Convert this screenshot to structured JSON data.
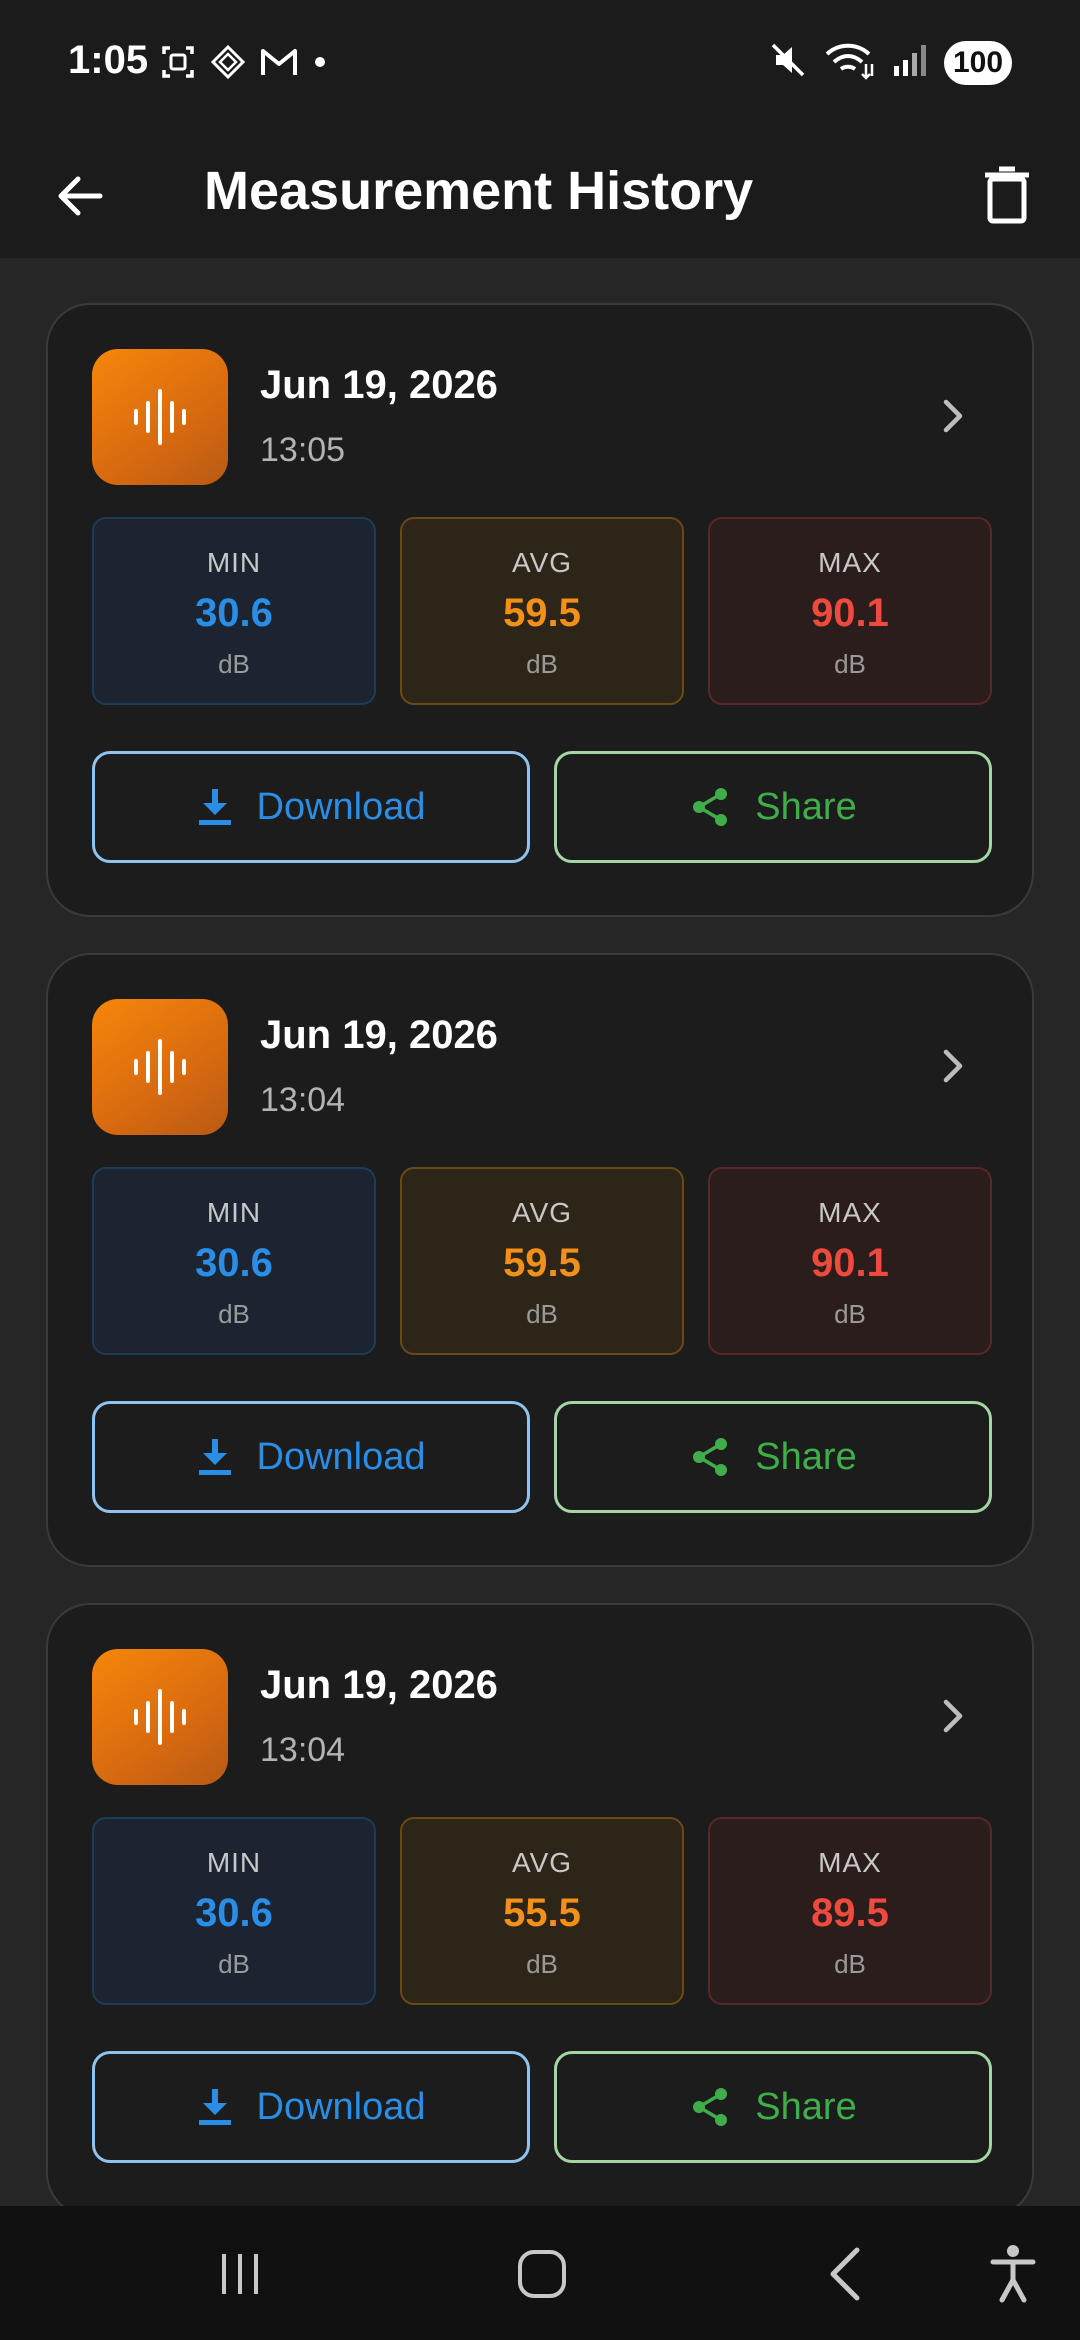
{
  "status_bar": {
    "time": "1:05",
    "battery": "100"
  },
  "app_bar": {
    "title": "Measurement History"
  },
  "cards": [
    {
      "date": "Jun 19, 2026",
      "time": "13:05",
      "min": {
        "label": "MIN",
        "value": "30.6",
        "unit": "dB"
      },
      "avg": {
        "label": "AVG",
        "value": "59.5",
        "unit": "dB"
      },
      "max": {
        "label": "MAX",
        "value": "90.1",
        "unit": "dB"
      },
      "download_label": "Download",
      "share_label": "Share"
    },
    {
      "date": "Jun 19, 2026",
      "time": "13:04",
      "min": {
        "label": "MIN",
        "value": "30.6",
        "unit": "dB"
      },
      "avg": {
        "label": "AVG",
        "value": "59.5",
        "unit": "dB"
      },
      "max": {
        "label": "MAX",
        "value": "90.1",
        "unit": "dB"
      },
      "download_label": "Download",
      "share_label": "Share"
    },
    {
      "date": "Jun 19, 2026",
      "time": "13:04",
      "min": {
        "label": "MIN",
        "value": "30.6",
        "unit": "dB"
      },
      "avg": {
        "label": "AVG",
        "value": "55.5",
        "unit": "dB"
      },
      "max": {
        "label": "MAX",
        "value": "89.5",
        "unit": "dB"
      },
      "download_label": "Download",
      "share_label": "Share"
    }
  ],
  "colors": {
    "min": "#2a8ee6",
    "avg": "#f3901a",
    "max": "#ee4a3e",
    "download": "#2a8ee6",
    "share": "#3fae4a",
    "icon_gradient_start": "#f7860a"
  },
  "icons": {
    "back": "arrow-left-icon",
    "delete": "trash-icon",
    "card": "sound-wave-icon",
    "chevron": "chevron-right-icon",
    "download": "download-icon",
    "share": "share-icon",
    "nav_recents": "recents-icon",
    "nav_home": "home-icon",
    "nav_back": "back-icon",
    "nav_accessibility": "accessibility-icon"
  }
}
